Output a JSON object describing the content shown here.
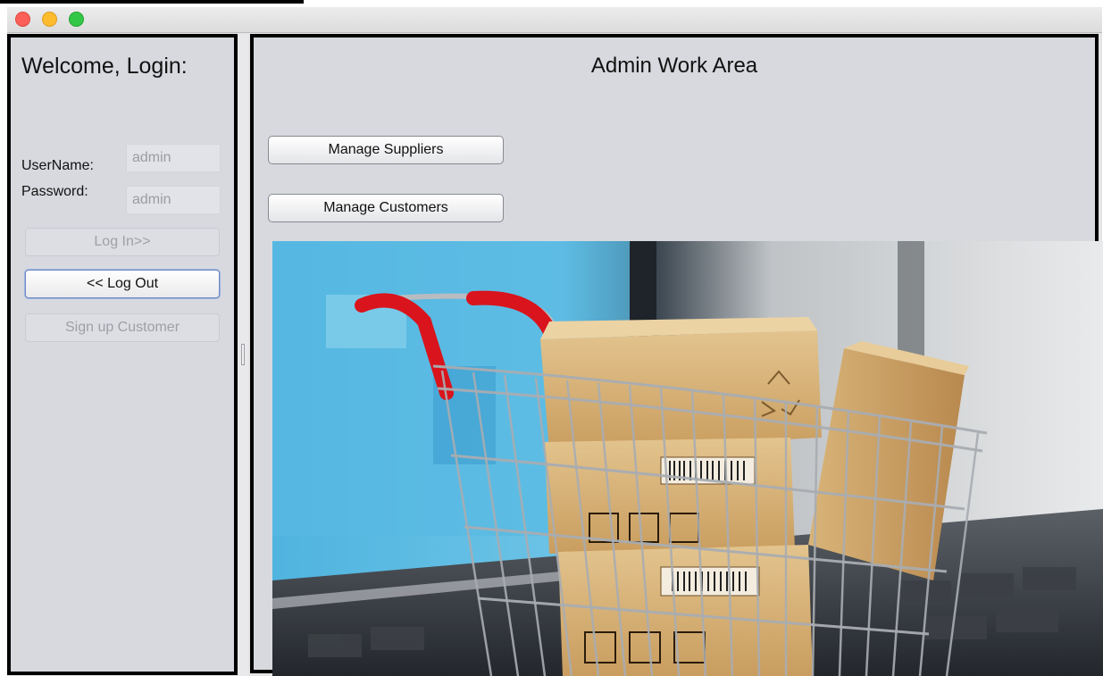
{
  "window": {
    "controls": [
      "close",
      "minimize",
      "maximize"
    ]
  },
  "login_panel": {
    "welcome": "Welcome, Login:",
    "username_label": "UserName:",
    "username_value": "admin",
    "password_label": "Password:",
    "password_value": "admin",
    "login_button": "Log In>>",
    "logout_button": "<< Log Out",
    "signup_button": "Sign up Customer"
  },
  "work_area": {
    "title": "Admin Work Area",
    "manage_suppliers_button": "Manage Suppliers",
    "manage_customers_button": "Manage Customers",
    "image": "shopping-cart-with-boxes-on-laptop"
  },
  "colors": {
    "panel_bg": "#d7d9df",
    "panel_border": "#000000",
    "close": "#fc5f57",
    "minimize": "#fdbc2e",
    "maximize": "#33c748",
    "cart_handle": "#d9141c",
    "box": "#d9b57e"
  }
}
